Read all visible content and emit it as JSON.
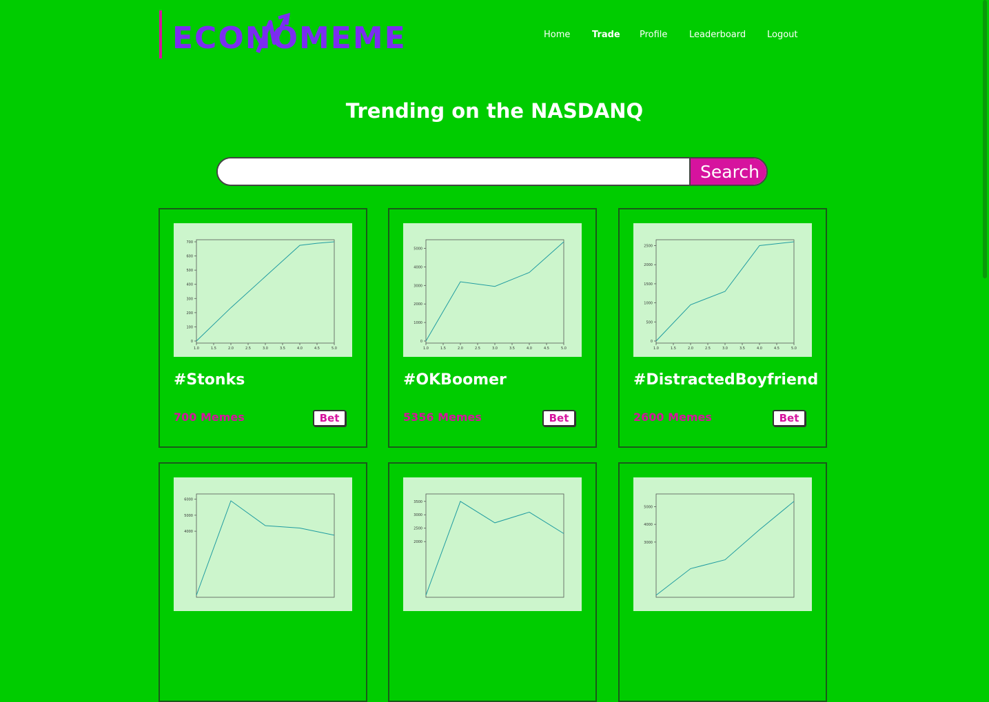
{
  "brand": {
    "logo_text": "ECONOMEME"
  },
  "nav": [
    {
      "label": "Home"
    },
    {
      "label": "Trade",
      "active": true
    },
    {
      "label": "Profile"
    },
    {
      "label": "Leaderboard"
    },
    {
      "label": "Logout"
    }
  ],
  "page": {
    "title": "Trending on the NASDANQ"
  },
  "search": {
    "value": "",
    "placeholder": "",
    "button_label": "Search"
  },
  "colors": {
    "background": "#00cc00",
    "accent": "#d6139e",
    "logo": "#7b2df0",
    "chart_bg": "#ccf5cc",
    "chart_line": "#1f9ba0"
  },
  "cards": [
    {
      "title": "#Stonks",
      "count": "700 Memes",
      "bet_label": "Bet"
    },
    {
      "title": "#OKBoomer",
      "count": "5356 Memes",
      "bet_label": "Bet"
    },
    {
      "title": "#DistractedBoyfriend",
      "count": "2600 Memes",
      "bet_label": "Bet"
    },
    {
      "title": "",
      "count": "",
      "bet_label": ""
    },
    {
      "title": "",
      "count": "",
      "bet_label": ""
    },
    {
      "title": "",
      "count": "",
      "bet_label": ""
    }
  ],
  "chart_data": [
    {
      "type": "line",
      "x": [
        1,
        2,
        3,
        4,
        4.5,
        5
      ],
      "y": [
        0,
        235,
        455,
        675,
        690,
        700
      ],
      "xlim": [
        1,
        5
      ],
      "ylim": [
        0,
        700
      ],
      "xticks": [
        "1.0",
        "1.5",
        "2.0",
        "2.5",
        "3.0",
        "3.5",
        "4.0",
        "4.5",
        "5.0"
      ],
      "yticks": [
        "0",
        "100",
        "200",
        "300",
        "400",
        "500",
        "600",
        "700"
      ],
      "grid": false
    },
    {
      "type": "line",
      "x": [
        1,
        2,
        3,
        4,
        5
      ],
      "y": [
        0,
        3200,
        2950,
        3700,
        5356
      ],
      "xlim": [
        1,
        5
      ],
      "ylim": [
        0,
        5356
      ],
      "xticks": [
        "1.0",
        "1.5",
        "2.0",
        "2.5",
        "3.0",
        "3.5",
        "4.0",
        "4.5",
        "5.0"
      ],
      "yticks": [
        "0",
        "1000",
        "2000",
        "3000",
        "4000",
        "5000"
      ],
      "grid": false
    },
    {
      "type": "line",
      "x": [
        1,
        2,
        3,
        4,
        5
      ],
      "y": [
        0,
        950,
        1300,
        2500,
        2600
      ],
      "xlim": [
        1,
        5
      ],
      "ylim": [
        0,
        2600
      ],
      "xticks": [
        "1.0",
        "1.5",
        "2.0",
        "2.5",
        "3.0",
        "3.5",
        "4.0",
        "4.5",
        "5.0"
      ],
      "yticks": [
        "0",
        "500",
        "1000",
        "1500",
        "2000",
        "2500"
      ],
      "grid": false
    },
    {
      "type": "line",
      "x": [
        1,
        2,
        3,
        4,
        5
      ],
      "y": [
        0,
        5900,
        4350,
        4200,
        3750
      ],
      "xlim": [
        1,
        5
      ],
      "ylim": [
        0,
        6200
      ],
      "xticks": [],
      "yticks": [
        "4000",
        "5000",
        "6000"
      ],
      "grid": false
    },
    {
      "type": "line",
      "x": [
        1,
        2,
        3,
        4,
        5
      ],
      "y": [
        0,
        3500,
        2700,
        3100,
        2300
      ],
      "xlim": [
        1,
        5
      ],
      "ylim": [
        0,
        3700
      ],
      "xticks": [],
      "yticks": [
        "2000",
        "2500",
        "3000",
        "3500"
      ],
      "grid": false
    },
    {
      "type": "line",
      "x": [
        1,
        2,
        3,
        4,
        5
      ],
      "y": [
        0,
        1500,
        2000,
        3700,
        5300
      ],
      "xlim": [
        1,
        5
      ],
      "ylim": [
        0,
        5600
      ],
      "xticks": [],
      "yticks": [
        "3000",
        "4000",
        "5000"
      ],
      "grid": false
    }
  ]
}
